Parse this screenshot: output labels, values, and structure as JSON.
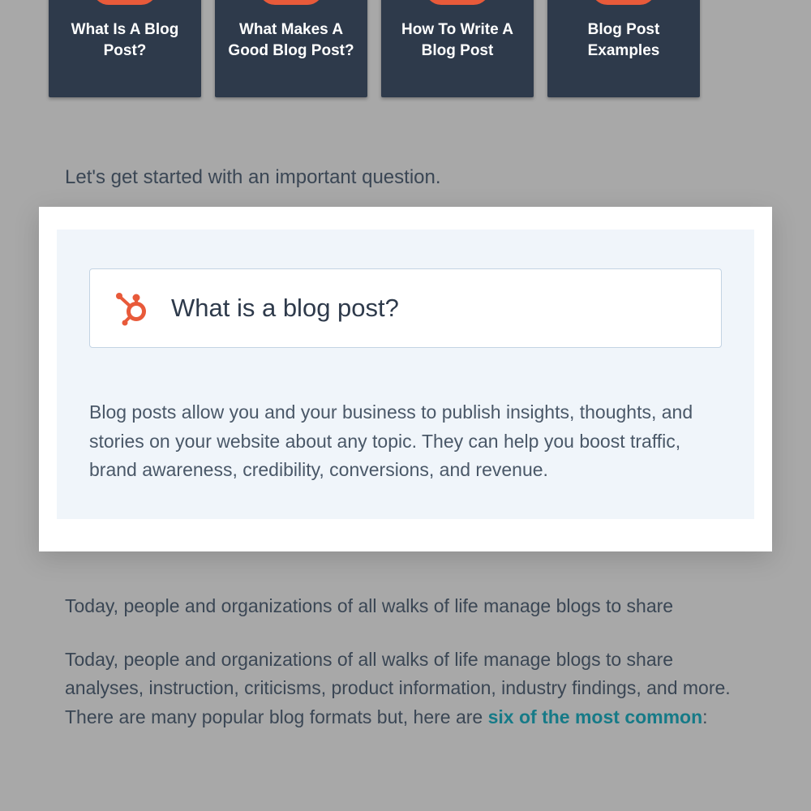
{
  "nav": {
    "cards": [
      {
        "label": "What Is A Blog Post?"
      },
      {
        "label": "What Makes A Good Blog Post?"
      },
      {
        "label": "How To Write A Blog Post"
      },
      {
        "label": "Blog Post Examples"
      }
    ]
  },
  "intro": "Let's get started with an important question.",
  "featured": {
    "question": "What is a blog post?",
    "answer": "Blog posts allow you and your business to publish insights, thoughts, and stories on your website about any topic. They can help you boost traffic, brand awareness, credibility, conversions, and revenue."
  },
  "body1": "Today, people and organizations of all walks of life manage blogs to share",
  "body2_pre": "Today, people and organizations of all walks of life manage blogs to share analyses, instruction, criticisms, product information, industry findings, and more. There are many popular blog formats but, here are ",
  "body2_link": "six of the most common",
  "body2_post": ":",
  "colors": {
    "accent": "#e85a3a",
    "card_bg": "#2e3a4b",
    "link": "#167a87"
  }
}
